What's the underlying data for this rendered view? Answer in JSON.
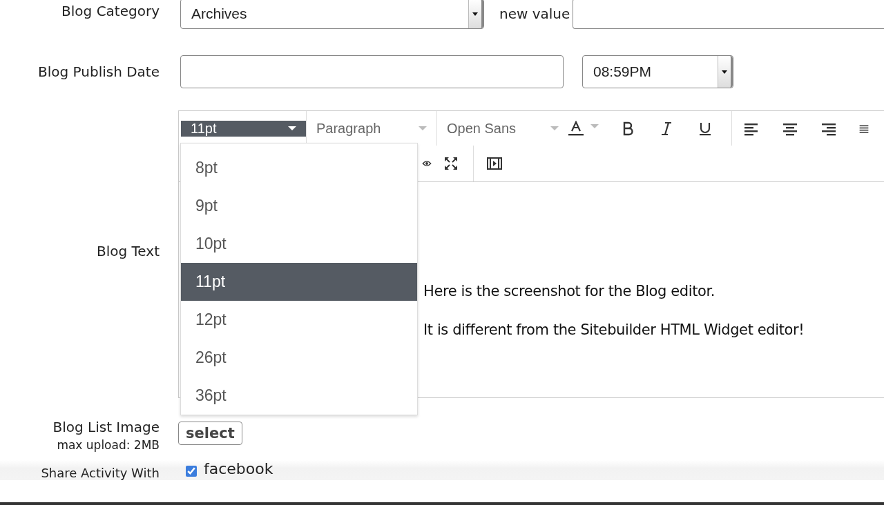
{
  "blog_category": {
    "label": "Blog Category",
    "value": "Archives",
    "new_value_label": "new value"
  },
  "publish_date": {
    "label": "Blog Publish Date",
    "time": "08:59PM"
  },
  "editor": {
    "label": "Blog Text",
    "font_size": "11pt",
    "block_format": "Paragraph",
    "font_family": "Open Sans",
    "content": [
      "Here is the screenshot for the Blog editor.",
      "It is different from the Sitebuilder HTML Widget editor!"
    ],
    "font_size_menu": [
      {
        "label": "8pt",
        "selected": false
      },
      {
        "label": "9pt",
        "selected": false
      },
      {
        "label": "10pt",
        "selected": false
      },
      {
        "label": "11pt",
        "selected": true
      },
      {
        "label": "12pt",
        "selected": false
      },
      {
        "label": "26pt",
        "selected": false
      },
      {
        "label": "36pt",
        "selected": false
      }
    ]
  },
  "list_image": {
    "label": "Blog List Image",
    "note": "max upload: 2MB",
    "button": "select"
  },
  "share": {
    "label": "Share Activity With",
    "options": [
      {
        "label": "facebook",
        "checked": true
      }
    ]
  }
}
